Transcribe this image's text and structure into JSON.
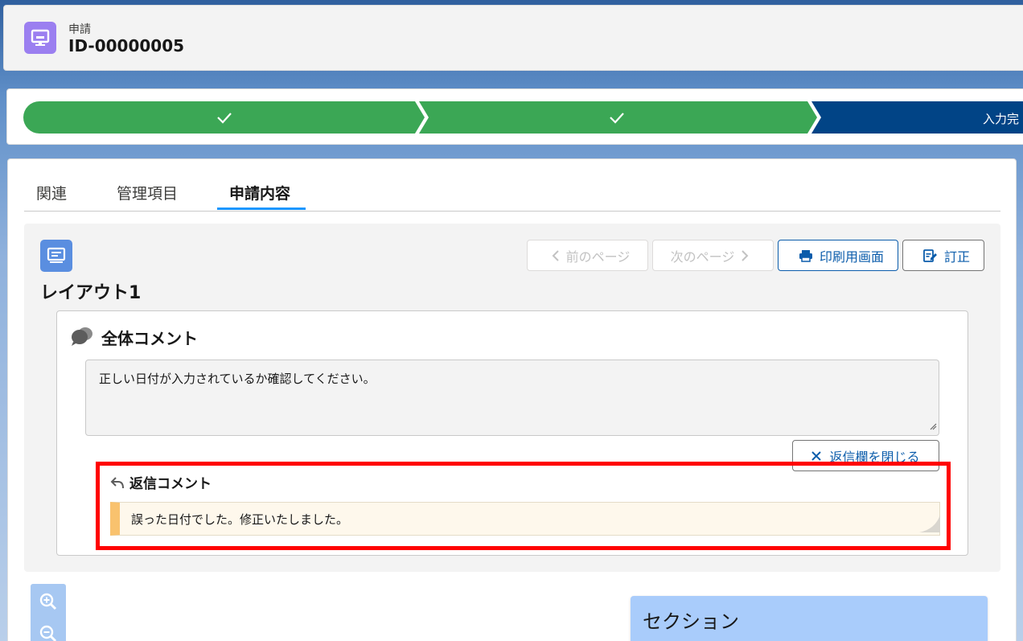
{
  "header": {
    "object_label": "申請",
    "record_name": "ID-00000005"
  },
  "path": {
    "stages": [
      {
        "state": "complete",
        "icon": "check-icon"
      },
      {
        "state": "complete",
        "icon": "check-icon"
      },
      {
        "state": "current",
        "label": "入力完"
      }
    ],
    "colors": {
      "complete": "#3ba755",
      "current": "#014486"
    }
  },
  "tabs": [
    {
      "label": "関連"
    },
    {
      "label": "管理項目"
    },
    {
      "label": "申請内容",
      "active": true
    }
  ],
  "layout": {
    "title": "レイアウト1",
    "buttons": {
      "prev_page": "前のページ",
      "next_page": "次のページ",
      "print_view": "印刷用画面",
      "correct": "訂正"
    }
  },
  "overall_comment": {
    "title": "全体コメント",
    "text": "正しい日付が入力されているか確認してください。",
    "close_reply_label": "返信欄を閉じる"
  },
  "reply_comment": {
    "title": "返信コメント",
    "text": "誤った日付でした。修正いたしました。"
  },
  "section": {
    "title": "セクション"
  }
}
